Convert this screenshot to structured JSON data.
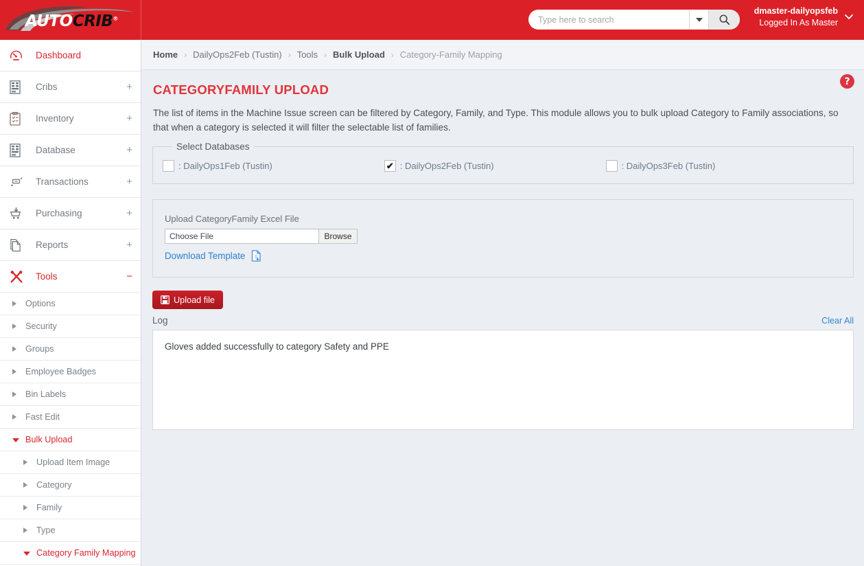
{
  "brand": {
    "logo_auto": "AUTO",
    "logo_crib": "CRIB",
    "accent_red": "#dc2027",
    "title_red": "#e0343b",
    "link_blue": "#2f7fd1"
  },
  "header": {
    "search_placeholder": "Type here to search",
    "search_value": "",
    "search_icon": "search-icon",
    "dropdown_icon": "chevron-down-icon",
    "user_name": "dmaster-dailyopsfeb",
    "user_role": "Logged In As Master",
    "user_chevron": "⌄"
  },
  "sidebar": {
    "items": [
      {
        "label": "Dashboard",
        "icon": "speedometer-icon",
        "expander": "",
        "active": true
      },
      {
        "label": "Cribs",
        "icon": "crib-machine-icon",
        "expander": "+",
        "active": false
      },
      {
        "label": "Inventory",
        "icon": "clipboard-icon",
        "expander": "+",
        "active": false
      },
      {
        "label": "Database",
        "icon": "database-machine-icon",
        "expander": "+",
        "active": false
      },
      {
        "label": "Transactions",
        "icon": "exchange-arrows-icon",
        "expander": "+",
        "active": false
      },
      {
        "label": "Purchasing",
        "icon": "shopping-cart-icon",
        "expander": "+",
        "active": false
      },
      {
        "label": "Reports",
        "icon": "documents-icon",
        "expander": "+",
        "active": false
      },
      {
        "label": "Tools",
        "icon": "tools-hammer-wrench-icon",
        "expander": "−",
        "active": true
      }
    ],
    "subitems": [
      {
        "label": "Options",
        "level": 1,
        "open": false
      },
      {
        "label": "Security",
        "level": 1,
        "open": false
      },
      {
        "label": "Groups",
        "level": 1,
        "open": false
      },
      {
        "label": "Employee Badges",
        "level": 1,
        "open": false
      },
      {
        "label": "Bin Labels",
        "level": 1,
        "open": false
      },
      {
        "label": "Fast Edit",
        "level": 1,
        "open": false
      },
      {
        "label": "Bulk Upload",
        "level": 1,
        "open": true
      },
      {
        "label": "Upload Item Image",
        "level": 2,
        "open": false
      },
      {
        "label": "Category",
        "level": 2,
        "open": false
      },
      {
        "label": "Family",
        "level": 2,
        "open": false
      },
      {
        "label": "Type",
        "level": 2,
        "open": false
      },
      {
        "label": "Category Family Mapping",
        "level": 2,
        "open": true
      }
    ]
  },
  "breadcrumb": [
    {
      "label": "Home",
      "style": "strong"
    },
    {
      "label": "DailyOps2Feb (Tustin)",
      "style": "link"
    },
    {
      "label": "Tools",
      "style": "link"
    },
    {
      "label": "Bulk Upload",
      "style": "strong"
    },
    {
      "label": "Category-Family Mapping",
      "style": "plain"
    }
  ],
  "breadcrumb_separator": "›",
  "page": {
    "title": "CATEGORYFAMILY UPLOAD",
    "help_icon": "question-mark-help-icon",
    "help_glyph": "?",
    "description": "The list of items in the Machine Issue screen can be filtered by Category, Family, and Type. This module allows you to bulk upload Category to Family associations, so that when a category is selected it will filter the selectable list of families."
  },
  "databases": {
    "legend": "Select Databases",
    "options": [
      {
        "label": ": DailyOps1Feb (Tustin)",
        "checked": false,
        "check_glyph": ""
      },
      {
        "label": ": DailyOps2Feb (Tustin)",
        "checked": true,
        "check_glyph": "✔"
      },
      {
        "label": ": DailyOps3Feb (Tustin)",
        "checked": false,
        "check_glyph": ""
      }
    ]
  },
  "upload": {
    "label": "Upload CategoryFamily Excel File",
    "file_value": "Choose File",
    "browse_label": "Browse",
    "download_label": "Download Template",
    "download_icon": "file-download-icon",
    "button_label": "Upload file",
    "button_icon": "save-floppy-icon"
  },
  "log": {
    "title": "Log",
    "clear_label": "Clear All",
    "lines": [
      "Gloves added successfully to category Safety and PPE"
    ]
  }
}
